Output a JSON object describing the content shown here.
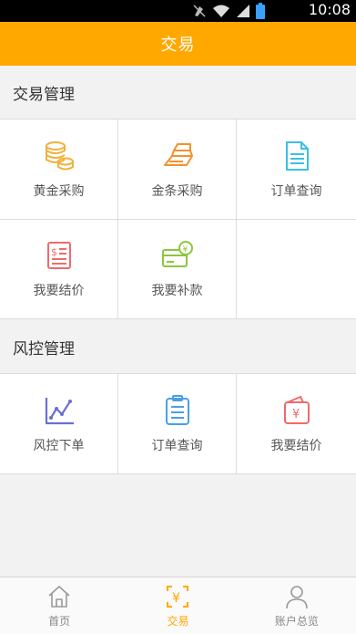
{
  "status_bar": {
    "time": "10:08"
  },
  "header": {
    "title": "交易"
  },
  "sections": [
    {
      "title": "交易管理",
      "items": [
        {
          "label": "黄金采购",
          "icon": "coins-icon"
        },
        {
          "label": "金条采购",
          "icon": "gold-bars-icon"
        },
        {
          "label": "订单查询",
          "icon": "document-icon"
        },
        {
          "label": "我要结价",
          "icon": "invoice-icon"
        },
        {
          "label": "我要补款",
          "icon": "card-yuan-icon"
        }
      ]
    },
    {
      "title": "风控管理",
      "items": [
        {
          "label": "风控下单",
          "icon": "trend-chart-icon"
        },
        {
          "label": "订单查询",
          "icon": "clipboard-icon"
        },
        {
          "label": "我要结价",
          "icon": "wallet-yuan-icon"
        }
      ]
    }
  ],
  "tab_bar": {
    "tabs": [
      {
        "label": "首页",
        "icon": "home-icon"
      },
      {
        "label": "交易",
        "icon": "trade-icon",
        "active": true
      },
      {
        "label": "账户总览",
        "icon": "user-icon"
      }
    ]
  },
  "colors": {
    "accent": "#ffa800",
    "gold": "#f0b23c",
    "orange": "#f5912b",
    "cyan": "#3bbfe6",
    "red": "#f06a6a",
    "green": "#8cc63e",
    "purple": "#6a6fd6",
    "blue": "#4a9fe6"
  }
}
